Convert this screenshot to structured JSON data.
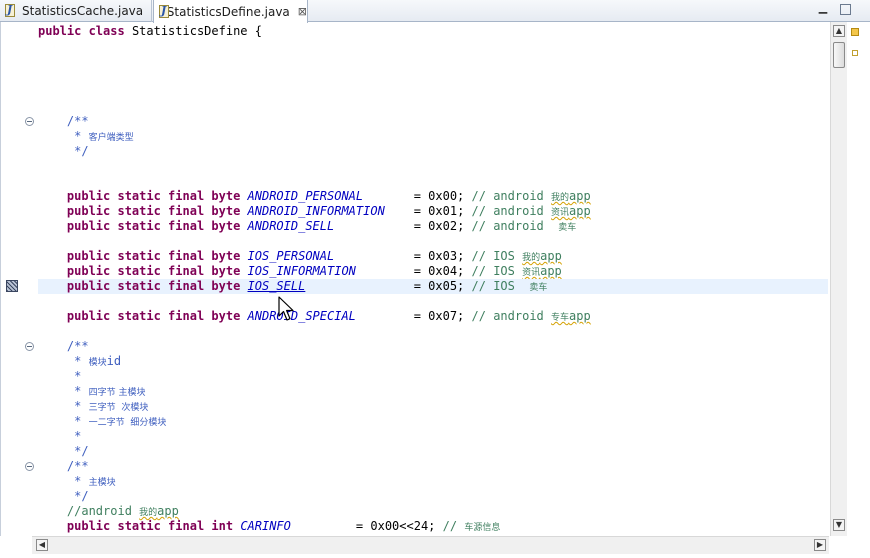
{
  "tabs": [
    {
      "label": "StatisticsCache.java",
      "active": false
    },
    {
      "label": "StatisticsDefine.java",
      "active": true
    }
  ],
  "tab_close_glyph": "⊠",
  "code": {
    "class_decl": {
      "kw": "public class",
      "name": "StatisticsDefine {"
    },
    "doc1": {
      "open": "/**",
      "body": " *",
      "body_text": "客户端类型",
      "close": " */"
    },
    "fields_a": [
      {
        "name": "ANDROID_PERSONAL",
        "pad": "       ",
        "value": "= 0x00;",
        "cmt": "// android ",
        "cmt_small": "我的",
        "cmt_tail": "app",
        "squig": true
      },
      {
        "name": "ANDROID_INFORMATION",
        "pad": "    ",
        "value": "= 0x01;",
        "cmt": "// android ",
        "cmt_small": "资讯",
        "cmt_tail": "app",
        "squig": true
      },
      {
        "name": "ANDROID_SELL",
        "pad": "           ",
        "value": "= 0x02;",
        "cmt": "// android  ",
        "cmt_small": "卖车",
        "cmt_tail": "",
        "squig": false
      }
    ],
    "fields_b": [
      {
        "name": "IOS_PERSONAL",
        "pad": "           ",
        "value": "= 0x03;",
        "cmt": "// IOS ",
        "cmt_small": "我的",
        "cmt_tail": "app",
        "squig": true
      },
      {
        "name": "IOS_INFORMATION",
        "pad": "        ",
        "value": "= 0x04;",
        "cmt": "// IOS ",
        "cmt_small": "资讯",
        "cmt_tail": "app",
        "squig": true
      },
      {
        "name": "IOS_SELL",
        "pad": "               ",
        "value": "= 0x05;",
        "cmt": "// IOS  ",
        "cmt_small": "卖车",
        "cmt_tail": "",
        "squig": false
      }
    ],
    "field_special": {
      "name": "ANDROID_SPECIAL",
      "pad": "        ",
      "value": "= 0x07;",
      "cmt": "// android ",
      "cmt_small": "专车",
      "cmt_tail": "app",
      "squig": true
    },
    "field_prefix": "public static final byte",
    "doc2": {
      "open": "/**",
      "l1_star": " * ",
      "l1_small": "模块",
      "l1_tail": "id",
      "l2": " *",
      "l3_star": " * ",
      "l3_small": "四字节 主模块",
      "l4_star": " * ",
      "l4_small": "三字节  次模块",
      "l5_star": " * ",
      "l5_small": "一二字节  细分模块",
      "l6": " *",
      "close": " */"
    },
    "doc3": {
      "open": "/**",
      "l1_star": " * ",
      "l1_small": "主模块",
      "close": " */"
    },
    "android_cmt": {
      "text": "//android ",
      "small": "我的",
      "tail": "app"
    },
    "int_field": {
      "prefix": "public static final int",
      "name": "CARINFO",
      "pad": "         ",
      "value": "= 0x00<<24;",
      "cmt": "// ",
      "cmt_small": "车源信息"
    }
  }
}
